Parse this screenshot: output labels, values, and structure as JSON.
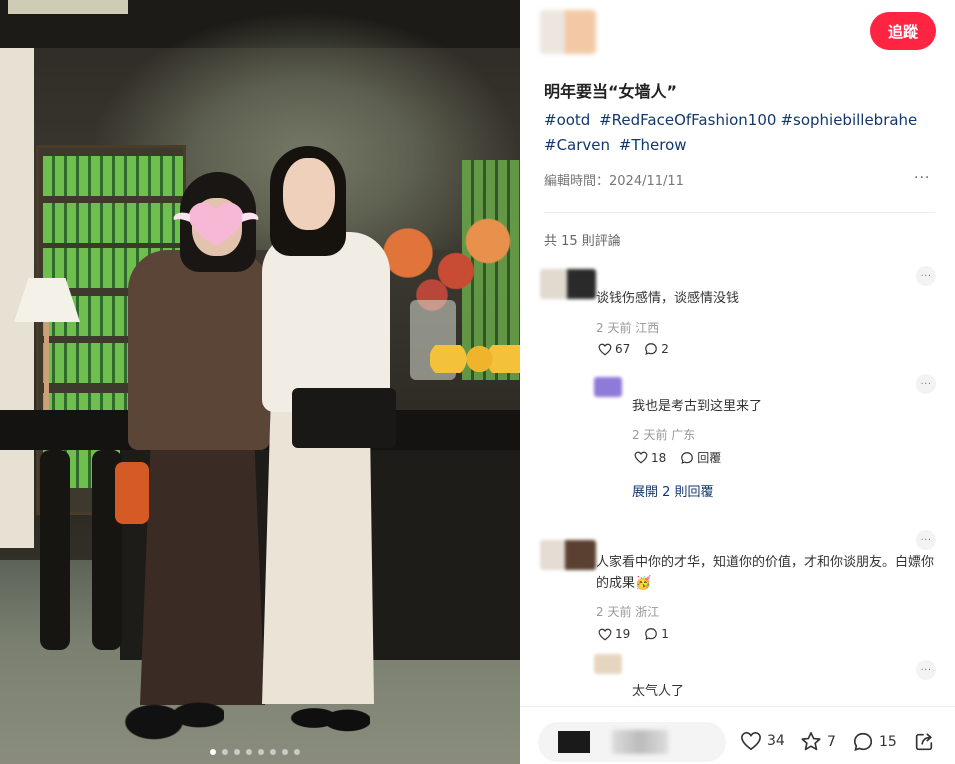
{
  "post": {
    "title": "明年要当“女墙人”",
    "tags": [
      "#ootd",
      "#RedFaceOfFashion100",
      "#sophiebillebrahe",
      "#Carven",
      "#Therow"
    ],
    "edit_time": "編輯時間：2024/11/11",
    "follow_label": "追蹤",
    "more_label": "···"
  },
  "carousel": {
    "total": 8,
    "active": 1
  },
  "comments": {
    "count_label": "共 15 則評論",
    "items": [
      {
        "text": "谈钱伤感情，谈感情没钱",
        "meta": "2 天前  江西",
        "likes": "67",
        "replies": "2",
        "more": "···"
      },
      {
        "text": "我也是考古到这里来了",
        "meta": "2 天前  广东",
        "likes": "18",
        "replies": "回覆",
        "more": "···",
        "expand": "展開 2 則回覆"
      },
      {
        "text": "人家看中你的才华，知道你的价值，才和你谈朋友。白嫖你的成果🥳",
        "meta": "2 天前  浙江",
        "likes": "19",
        "replies": "1",
        "more": "···"
      },
      {
        "text": "太气人了",
        "more": "···"
      }
    ]
  },
  "bottom_bar": {
    "likes": "34",
    "stars": "7",
    "comments": "15"
  },
  "colors": {
    "accent": "#ff2442",
    "tag": "#13386c"
  }
}
